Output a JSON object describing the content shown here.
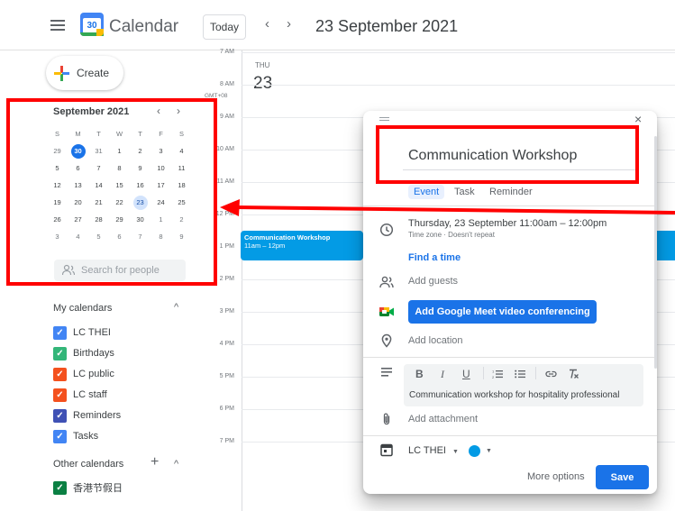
{
  "header": {
    "app_name": "Calendar",
    "logo_day": "30",
    "today_label": "Today",
    "date_title": "23 September 2021"
  },
  "sidebar": {
    "create_label": "Create",
    "mini_calendar": {
      "title": "September 2021",
      "weekdays": [
        "S",
        "M",
        "T",
        "W",
        "T",
        "F",
        "S"
      ],
      "weeks": [
        [
          "29",
          "30",
          "31",
          "1",
          "2",
          "3",
          "4"
        ],
        [
          "5",
          "6",
          "7",
          "8",
          "9",
          "10",
          "11"
        ],
        [
          "12",
          "13",
          "14",
          "15",
          "16",
          "17",
          "18"
        ],
        [
          "19",
          "20",
          "21",
          "22",
          "23",
          "24",
          "25"
        ],
        [
          "26",
          "27",
          "28",
          "29",
          "30",
          "1",
          "2"
        ],
        [
          "3",
          "4",
          "5",
          "6",
          "7",
          "8",
          "9"
        ]
      ],
      "today": "30",
      "selected": "23"
    },
    "search_people_placeholder": "Search for people",
    "my_calendars_title": "My calendars",
    "my_calendars": [
      {
        "label": "LC THEI",
        "color": "#4285f4"
      },
      {
        "label": "Birthdays",
        "color": "#33b679"
      },
      {
        "label": "LC public",
        "color": "#f4511e"
      },
      {
        "label": "LC staff",
        "color": "#f4511e"
      },
      {
        "label": "Reminders",
        "color": "#3f51b5"
      },
      {
        "label": "Tasks",
        "color": "#4285f4"
      }
    ],
    "other_calendars_title": "Other calendars",
    "other_calendars": [
      {
        "label": "香港节假日",
        "color": "#0b8043"
      }
    ]
  },
  "day_view": {
    "day_of_week": "THU",
    "day_number": "23",
    "timezone": "GMT+08",
    "time_labels": [
      "7 AM",
      "8 AM",
      "9 AM",
      "10 AM",
      "11 AM",
      "12 PM",
      "1 PM",
      "2 PM",
      "3 PM",
      "4 PM",
      "5 PM",
      "6 PM",
      "7 PM"
    ],
    "event": {
      "title": "Communication Workshop",
      "time": "11am – 12pm",
      "color": "#039be5"
    }
  },
  "dialog": {
    "title_value": "Communication Workshop",
    "tabs": [
      "Event",
      "Task",
      "Reminder"
    ],
    "active_tab": "Event",
    "date_line": "Thursday, 23 September   11:00am  –  12:00pm",
    "repeat_line": "Time zone · Doesn't repeat",
    "find_time": "Find a time",
    "add_guests": "Add guests",
    "meet_button": "Add Google Meet video conferencing",
    "add_location": "Add location",
    "description": "Communication workshop for hospitality professional",
    "add_attachment": "Add attachment",
    "calendar_select": "LC THEI",
    "event_color": "#039be5",
    "more_options": "More options",
    "save": "Save"
  },
  "annotations": {
    "highlight_color": "#ff0000"
  }
}
